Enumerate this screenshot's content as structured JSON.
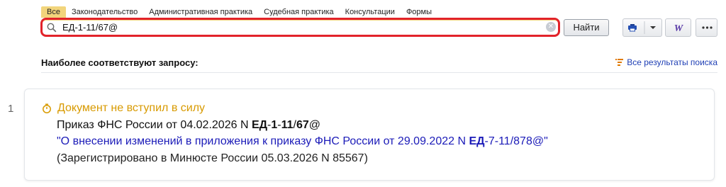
{
  "tabs": [
    "Все",
    "Законодательство",
    "Административная практика",
    "Судебная практика",
    "Консультации",
    "Формы"
  ],
  "search": {
    "value": "ЕД-1-11/67@"
  },
  "find_button": "Найти",
  "heading": "Наиболее соответствуют запросу:",
  "all_results": "Все результаты поиска",
  "result": {
    "number": "1",
    "status": "Документ не вступил в силу",
    "line2_prefix": "Приказ ФНС России от 04.02.2026 N ",
    "line2_hl1": "ЕД",
    "line2_sep1": "-",
    "line2_hl2": "1",
    "line2_sep2": "-",
    "line2_hl3": "11",
    "line2_sep3": "/",
    "line2_hl4": "67",
    "line2_suffix": "@",
    "title_prefix": "\"О внесении изменений в приложения к приказу ФНС России от 29.09.2022 N ",
    "title_hl": "ЕД",
    "title_suffix": "-7-11/878@\"",
    "registration": "(Зарегистрировано в Минюсте России 05.03.2026 N 85567)"
  },
  "icons": {
    "search": "search-icon",
    "clear": "clear-icon",
    "print": "print-icon",
    "word": "word-icon",
    "more": "more-icon",
    "status": "clock-icon"
  },
  "colors": {
    "search_border": "#e2232a",
    "active_tab": "#f2d57c",
    "status": "#d89a00",
    "link": "#1b1bb8"
  }
}
